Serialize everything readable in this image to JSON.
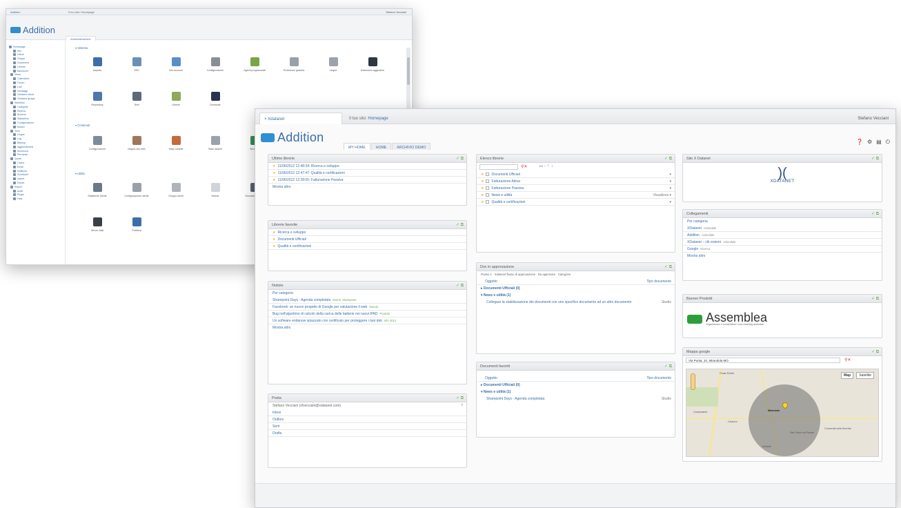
{
  "back": {
    "tab": "Addition",
    "path": "Il tuo sito: Homepage",
    "user": "Stefano Vecciani",
    "logo": "Addition",
    "tab_label": "Amministrazione",
    "sidebar": [
      "Homepage",
      "Sito",
      "Utenti",
      "Gruppi",
      "Documenti",
      "Librerie",
      "Bacheche",
      "News",
      "Calendario",
      "Forum",
      "Link",
      "Sondaggi",
      "Gestione utenti",
      "Gestione gruppi",
      "Workflow",
      "Categorie",
      "Ricerca",
      "Archivio",
      "Statistiche",
      "Configurazione",
      "Moduli",
      "Temi",
      "Lingue",
      "Log",
      "Backup",
      "Aggiornamenti",
      "Sicurezza",
      "Permessi",
      "Quote",
      "Cache",
      "Email",
      "Notifiche",
      "Scheduler",
      "Import",
      "Export",
      "Report",
      "Audit",
      "Plugin",
      "Help"
    ],
    "sections": [
      "Sistema",
      "Contenuti",
      "Utilità"
    ],
    "icons_row1": [
      "Aspetto",
      "SEO",
      "Info account",
      "Configurazione",
      "Agenti programmati",
      "Protezione gratuita",
      "Lingue",
      "Estensioni aggiuntive"
    ],
    "icons_row2": [
      "Repository",
      "Temi",
      "Librerie",
      "Domande"
    ],
    "icons_row3": [
      "Configurazione",
      "Mappa sito web",
      "Stato cartelle",
      "Stato allarmi",
      "Struttura"
    ],
    "icons_row4": [
      "Statistiche utente",
      "Configurazione utente",
      "Gruppo utenti",
      "Notizie",
      "Documentazione"
    ],
    "icons_row5": [
      "Server Mail",
      "Pubblica"
    ]
  },
  "front": {
    "tab": "Xdatanet",
    "path_prefix": "Il tuo sito:",
    "path_link": "Homepage",
    "user": "Stefano Vecciani",
    "logo": "Addition",
    "nav": [
      "MY HOME",
      "HOME",
      "ARCHIVIO DEMO"
    ],
    "col1": {
      "ultime": {
        "title": "Ultime librerie",
        "items": [
          "11/06/2012 12:48:34: Ricerca e sviluppo",
          "11/06/2012 12:47:47: Qualità e certificazioni",
          "11/06/2012 12:28:05: Fatturazione Passiva"
        ],
        "more": "Mostra altro"
      },
      "favorite": {
        "title": "Librerie favorite",
        "items": [
          "Ricerca e sviluppo",
          "Documenti Ufficiali",
          "Qualità e certificazioni"
        ]
      },
      "notizie": {
        "title": "Notizie",
        "category": "Per categoria",
        "items": [
          {
            "text": "Sharepoint Days - Agenda completata",
            "tag": "Eventi, Sharepoint"
          },
          {
            "text": "Facebook: un nuovo progetto di Google per valutazione il web",
            "tag": "Mondo"
          },
          {
            "text": "Bug nell'algoritmo di calcolo della carica delle batterie nei nuovi iPAD",
            "tag": "Prodotti"
          },
          {
            "text": "Un software endanow spiazzato con certificato per proteggere i tuoi dati",
            "tag": "Info 2012"
          }
        ],
        "more": "Mostra altro"
      },
      "posta": {
        "title": "Posta",
        "account": "Stefano Vecciani (sfvecciani@xdatanet.com)",
        "folders": [
          "Inbox",
          "Outbox",
          "Sent",
          "Drafts"
        ]
      }
    },
    "col2": {
      "elenco": {
        "title": "Elenco librerie",
        "items": [
          "Documenti Ufficiali",
          "Fatturazione Attiva",
          "Fatturazione Passiva",
          "News e utilità",
          "Qualità e certificazioni"
        ],
        "badge": "Visualizza"
      },
      "approvazione": {
        "title": "Doc in approvazione",
        "crumb": "Flusso 1 · Xdatanet flusso di approvazione · Da approvare · Categorie",
        "col_subject": "Oggetto",
        "col_type": "Tipo documento",
        "groups": [
          "Documenti Ufficiali (0)",
          "News e utilità (1)"
        ],
        "item": "Collegare la stabilizzazione dei documenti con uno specifico documento ad un altro documento",
        "item_type": "Studio"
      },
      "preferiti": {
        "title": "Documenti favoriti",
        "col_subject": "Oggetto",
        "col_type": "Tipo documento",
        "groups": [
          "Documenti Ufficiali (0)",
          "News e utilità (1)"
        ],
        "item": "Sharepoint Days - Agenda completata",
        "item_type": "Studio"
      }
    },
    "col3": {
      "sito": {
        "title": "Sito X Datanet",
        "brand": "XDATANET"
      },
      "collegamenti": {
        "title": "Collegamenti",
        "category": "Per categoria",
        "items": [
          {
            "text": "XDatanet",
            "tag": "Aziendale"
          },
          {
            "text": "Addition",
            "tag": "Aziendale"
          },
          {
            "text": "XDatanet – ctk esterni",
            "tag": "Aziendale"
          },
          {
            "text": "Google",
            "tag": "Ricerca"
          }
        ],
        "more": "Mostra altro"
      },
      "banner": {
        "title": "Banner Prodotti",
        "brand": "Assemblea",
        "tagline": "Organizzare e condividere i tuoi meeting aziendali"
      },
      "mappa": {
        "title": "Mappa google",
        "address": "Via Punta, 10, Mirandola MO",
        "btn_map": "Map",
        "btn_sat": "Satellite",
        "labels": [
          "Finale Emilia",
          "Mirandola",
          "Camposanto",
          "San Felice sul Panaro",
          "Cavezzo",
          "Concordia sulla Secchia",
          "Medolla"
        ]
      }
    }
  },
  "colors": {
    "accent": "#3a6ea8",
    "brand_blue": "#2f8fd1",
    "ok_green": "#6aa84f",
    "star": "#e9b520"
  }
}
